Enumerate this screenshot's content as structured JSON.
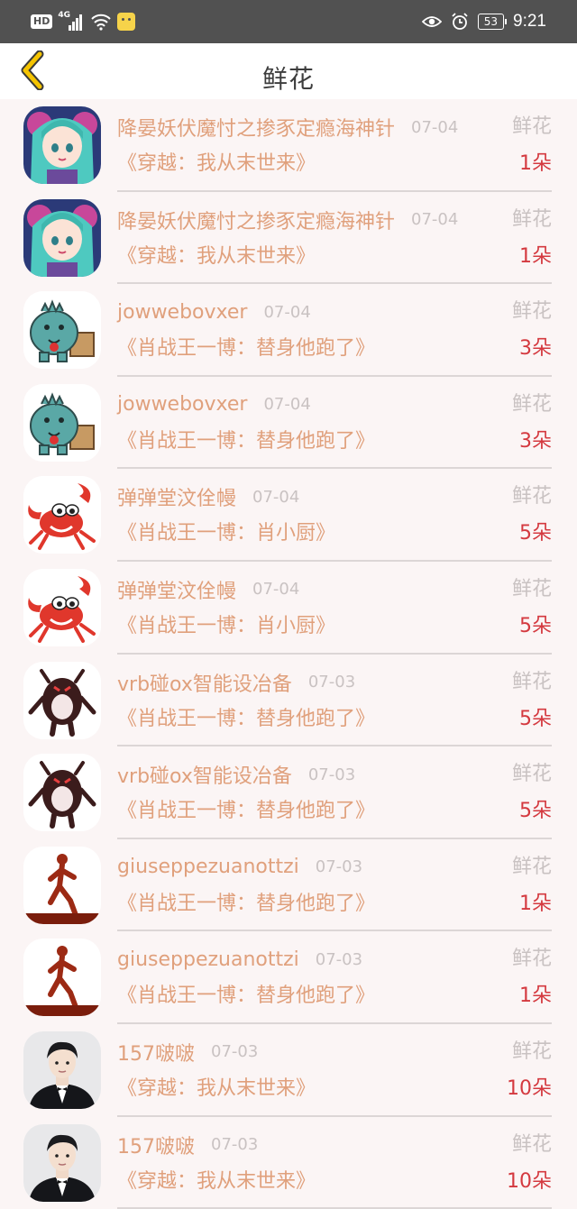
{
  "status_bar": {
    "network_badge": "HD",
    "signal_tag": "4G",
    "battery": "53",
    "time": "9:21",
    "icons": [
      "hd-icon",
      "signal-icon",
      "wifi-icon",
      "notification-face-icon",
      "eye-icon",
      "alarm-icon",
      "battery-icon"
    ]
  },
  "header": {
    "title": "鲜花",
    "back_icon": "chevron-left-icon",
    "accent_color": "#f5c400"
  },
  "colors": {
    "name_text": "#e0a07c",
    "meta_text": "#c9c2c2",
    "count_text": "#d4393f",
    "background": "#fbf5f5"
  },
  "records": [
    {
      "user": "降晏妖伏魔忖之掺豕定瘾海神针",
      "date": "07-04",
      "kind": "鲜花",
      "book": "《穿越：我从末世来》",
      "count": "1朵",
      "avatar": "anime-girl-teal-hair"
    },
    {
      "user": "降晏妖伏魔忖之掺豕定瘾海神针",
      "date": "07-04",
      "kind": "鲜花",
      "book": "《穿越：我从末世来》",
      "count": "1朵",
      "avatar": "anime-girl-teal-hair"
    },
    {
      "user": "jowwebovxer",
      "date": "07-04",
      "kind": "鲜花",
      "book": "《肖战王一博：替身他跑了》",
      "count": "3朵",
      "avatar": "teal-dinosaur-cartoon"
    },
    {
      "user": "jowwebovxer",
      "date": "07-04",
      "kind": "鲜花",
      "book": "《肖战王一博：替身他跑了》",
      "count": "3朵",
      "avatar": "teal-dinosaur-cartoon"
    },
    {
      "user": "弹弹堂汶佺幔",
      "date": "07-04",
      "kind": "鲜花",
      "book": "《肖战王一博：肖小厨》",
      "count": "5朵",
      "avatar": "red-crab-cartoon"
    },
    {
      "user": "弹弹堂汶佺幔",
      "date": "07-04",
      "kind": "鲜花",
      "book": "《肖战王一博：肖小厨》",
      "count": "5朵",
      "avatar": "red-crab-cartoon"
    },
    {
      "user": "vrb碰ox智能设冶备",
      "date": "07-03",
      "kind": "鲜花",
      "book": "《肖战王一博：替身他跑了》",
      "count": "5朵",
      "avatar": "dark-monster-cartoon"
    },
    {
      "user": "vrb碰ox智能设冶备",
      "date": "07-03",
      "kind": "鲜花",
      "book": "《肖战王一博：替身他跑了》",
      "count": "5朵",
      "avatar": "dark-monster-cartoon"
    },
    {
      "user": "giuseppezuanottzi",
      "date": "07-03",
      "kind": "鲜花",
      "book": "《肖战王一博：替身他跑了》",
      "count": "1朵",
      "avatar": "runner-sunset"
    },
    {
      "user": "giuseppezuanottzi",
      "date": "07-03",
      "kind": "鲜花",
      "book": "《肖战王一博：替身他跑了》",
      "count": "1朵",
      "avatar": "runner-sunset"
    },
    {
      "user": "157啵啵",
      "date": "07-03",
      "kind": "鲜花",
      "book": "《穿越：我从末世来》",
      "count": "10朵",
      "avatar": "man-in-tuxedo"
    },
    {
      "user": "157啵啵",
      "date": "07-03",
      "kind": "鲜花",
      "book": "《穿越：我从末世来》",
      "count": "10朵",
      "avatar": "man-in-tuxedo"
    }
  ]
}
